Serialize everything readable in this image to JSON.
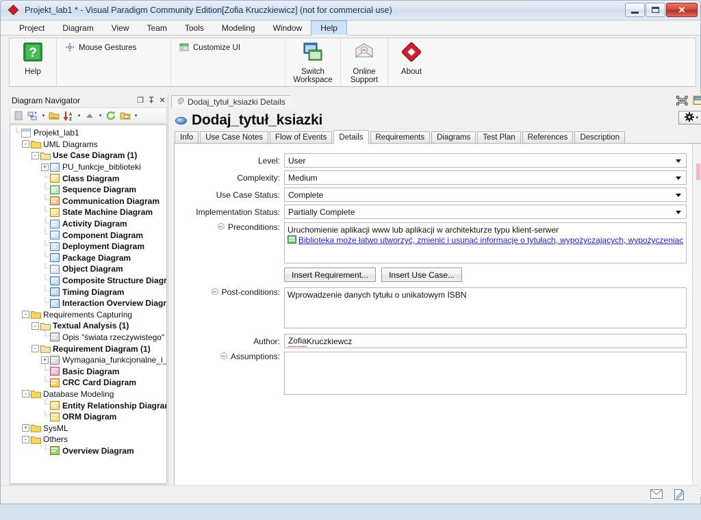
{
  "window": {
    "title": "Projekt_lab1 * - Visual Paradigm Community Edition[Zofia Kruczkiewicz] (not for commercial use)",
    "app_icon": "visual-paradigm-diamond-icon",
    "buttons": {
      "minimize": "minimize-icon",
      "maximize": "maximize-icon",
      "close": "✕"
    }
  },
  "menu": {
    "items": [
      {
        "label": "Project",
        "active": false
      },
      {
        "label": "Diagram",
        "active": false
      },
      {
        "label": "View",
        "active": false
      },
      {
        "label": "Team",
        "active": false
      },
      {
        "label": "Tools",
        "active": false
      },
      {
        "label": "Modeling",
        "active": false
      },
      {
        "label": "Window",
        "active": false
      },
      {
        "label": "Help",
        "active": true
      }
    ]
  },
  "ribbon": {
    "groups": [
      {
        "big": [
          {
            "label": "Help",
            "icon": "help-question-icon"
          }
        ],
        "small": []
      },
      {
        "big": [],
        "small": [
          {
            "label": "Mouse Gestures",
            "icon": "mouse-gestures-icon"
          }
        ]
      },
      {
        "big": [],
        "small": [
          {
            "label": "Customize UI",
            "icon": "customize-ui-icon"
          }
        ]
      },
      {
        "big": [
          {
            "label": "Switch\nWorkspace",
            "label_line1": "Switch",
            "label_line2": "Workspace",
            "icon": "switch-workspace-icon"
          }
        ],
        "small": []
      },
      {
        "big": [
          {
            "label_line1": "Online",
            "label_line2": "Support",
            "icon": "online-support-envelope-icon"
          }
        ],
        "small": []
      },
      {
        "big": [
          {
            "label_line1": "About",
            "label_line2": "",
            "icon": "about-diamond-icon"
          }
        ],
        "small": []
      }
    ]
  },
  "navigator": {
    "title": "Diagram Navigator",
    "header_buttons": [
      {
        "name": "restore-icon",
        "glyph": "❐"
      },
      {
        "name": "pin-icon",
        "glyph": "⇱"
      },
      {
        "name": "close-icon",
        "glyph": "✕"
      }
    ],
    "toolbar": [
      {
        "name": "blank-page-icon"
      },
      {
        "name": "new-diagram-icon"
      },
      {
        "name": "dropdown-arrow-1"
      },
      {
        "name": "open-folder-icon"
      },
      {
        "name": "sort-az-icon"
      },
      {
        "name": "dropdown-arrow-2"
      },
      {
        "name": "collapse-up-icon"
      },
      {
        "name": "dropdown-arrow-3"
      },
      {
        "name": "refresh-icon"
      },
      {
        "name": "folder-new-icon"
      },
      {
        "name": "dropdown-arrow-4"
      }
    ],
    "tree": [
      {
        "label": "Projekt_lab1",
        "depth": 0,
        "expander": "",
        "icon": "project-icon",
        "bold": false
      },
      {
        "label": "UML Diagrams",
        "depth": 1,
        "expander": "-",
        "icon": "folder-open-icon",
        "bold": false
      },
      {
        "label": "Use Case Diagram (1)",
        "depth": 2,
        "expander": "-",
        "icon": "folder-diagram-icon",
        "bold": true
      },
      {
        "label": "PU_funkcje_biblioteki",
        "depth": 3,
        "expander": "+",
        "icon": "usecase-diagram-icon",
        "bold": false
      },
      {
        "label": "Class Diagram",
        "depth": 3,
        "expander": "",
        "icon": "class-diagram-icon",
        "bold": true
      },
      {
        "label": "Sequence Diagram",
        "depth": 3,
        "expander": "",
        "icon": "sequence-diagram-icon",
        "bold": true
      },
      {
        "label": "Communication Diagram",
        "depth": 3,
        "expander": "",
        "icon": "communication-diagram-icon",
        "bold": true
      },
      {
        "label": "State Machine Diagram",
        "depth": 3,
        "expander": "",
        "icon": "state-machine-diagram-icon",
        "bold": true
      },
      {
        "label": "Activity Diagram",
        "depth": 3,
        "expander": "",
        "icon": "activity-diagram-icon",
        "bold": true
      },
      {
        "label": "Component Diagram",
        "depth": 3,
        "expander": "",
        "icon": "component-diagram-icon",
        "bold": true
      },
      {
        "label": "Deployment Diagram",
        "depth": 3,
        "expander": "",
        "icon": "deployment-diagram-icon",
        "bold": true
      },
      {
        "label": "Package Diagram",
        "depth": 3,
        "expander": "",
        "icon": "package-diagram-icon",
        "bold": true
      },
      {
        "label": "Object Diagram",
        "depth": 3,
        "expander": "",
        "icon": "object-diagram-icon",
        "bold": true
      },
      {
        "label": "Composite Structure Diagram",
        "depth": 3,
        "expander": "",
        "icon": "composite-structure-diagram-icon",
        "bold": true
      },
      {
        "label": "Timing Diagram",
        "depth": 3,
        "expander": "",
        "icon": "timing-diagram-icon",
        "bold": true
      },
      {
        "label": "Interaction Overview Diagram",
        "depth": 3,
        "expander": "",
        "icon": "interaction-overview-diagram-icon",
        "bold": true
      },
      {
        "label": "Requirements Capturing",
        "depth": 1,
        "expander": "-",
        "icon": "folder-open-icon",
        "bold": false
      },
      {
        "label": "Textual Analysis (1)",
        "depth": 2,
        "expander": "-",
        "icon": "folder-diagram-icon",
        "bold": true
      },
      {
        "label": "Opis \"świata rzeczywistego\"",
        "depth": 3,
        "expander": "",
        "icon": "textual-analysis-icon",
        "bold": false
      },
      {
        "label": "Requirement Diagram (1)",
        "depth": 2,
        "expander": "-",
        "icon": "folder-diagram-icon",
        "bold": true
      },
      {
        "label": "Wymagania_funkcjonalne_i_n",
        "depth": 3,
        "expander": "+",
        "icon": "requirement-diagram-icon",
        "bold": false
      },
      {
        "label": "Basic Diagram",
        "depth": 3,
        "expander": "",
        "icon": "basic-diagram-icon",
        "bold": true
      },
      {
        "label": "CRC Card Diagram",
        "depth": 3,
        "expander": "",
        "icon": "crc-card-diagram-icon",
        "bold": true
      },
      {
        "label": "Database Modeling",
        "depth": 1,
        "expander": "-",
        "icon": "folder-open-icon",
        "bold": false
      },
      {
        "label": "Entity Relationship Diagram",
        "depth": 3,
        "expander": "",
        "icon": "erd-icon",
        "bold": true
      },
      {
        "label": "ORM Diagram",
        "depth": 3,
        "expander": "",
        "icon": "orm-diagram-icon",
        "bold": true
      },
      {
        "label": "SysML",
        "depth": 1,
        "expander": "+",
        "icon": "folder-closed-icon",
        "bold": false
      },
      {
        "label": "Others",
        "depth": 1,
        "expander": "-",
        "icon": "folder-open-icon",
        "bold": false
      },
      {
        "label": "Overview Diagram",
        "depth": 3,
        "expander": "",
        "icon": "overview-diagram-icon",
        "bold": true
      }
    ],
    "hscroll": {
      "left_arrow": "◀",
      "right_arrow": "▶",
      "thumb_grip": "|||"
    }
  },
  "editor": {
    "doc_tab": {
      "label": "Dodaj_tytuł_ksiazki Details",
      "icon": "paperclip-icon"
    },
    "top_icons": [
      {
        "name": "fit-view-icon"
      },
      {
        "name": "open-diagram-icon"
      }
    ],
    "page_title": "Dodaj_tytuł_ksiazki",
    "page_title_icon": "use-case-ellipse-icon",
    "gear_button": {
      "icon": "gear-icon",
      "arrow": "▾"
    },
    "tabs": [
      {
        "label": "Info",
        "active": false
      },
      {
        "label": "Use Case Notes",
        "active": false
      },
      {
        "label": "Flow of Events",
        "active": false
      },
      {
        "label": "Details",
        "active": true
      },
      {
        "label": "Requirements",
        "active": false
      },
      {
        "label": "Diagrams",
        "active": false
      },
      {
        "label": "Test Plan",
        "active": false
      },
      {
        "label": "References",
        "active": false
      },
      {
        "label": "Description",
        "active": false
      }
    ]
  },
  "form": {
    "level": {
      "label": "Level:",
      "value": "User"
    },
    "complexity": {
      "label": "Complexity:",
      "value": "Medium"
    },
    "use_case_status": {
      "label": "Use Case Status:",
      "value": "Complete"
    },
    "implementation_status": {
      "label": "Implementation Status:",
      "value": "Partially Complete"
    },
    "preconditions": {
      "label": "Preconditions:",
      "line1": "Uruchomienie aplikacji www lub aplikacji w architekturze typu klient-serwer",
      "link": "Biblioteka może łatwo utworzyć, zmienić i usunąć informację o tytułach, wypożyczających, wypożyczeniac",
      "link_icon": "requirement-link-icon"
    },
    "insert_requirement_button": "Insert Requirement...",
    "insert_use_case_button": "Insert Use Case...",
    "post_conditions": {
      "label": "Post-conditions:",
      "value": "Wprowadzenie danych tytułu o unikatowym ISBN"
    },
    "author": {
      "label": "Author:",
      "value": "Zofia Kruczkiewcz",
      "misspelled_word": "Zofia",
      "rest": " Kruczkiewcz"
    },
    "assumptions": {
      "label": "Assumptions:",
      "value": ""
    }
  },
  "status_bar": {
    "icons": [
      {
        "name": "message-envelope-icon"
      },
      {
        "name": "edit-note-icon"
      }
    ]
  }
}
